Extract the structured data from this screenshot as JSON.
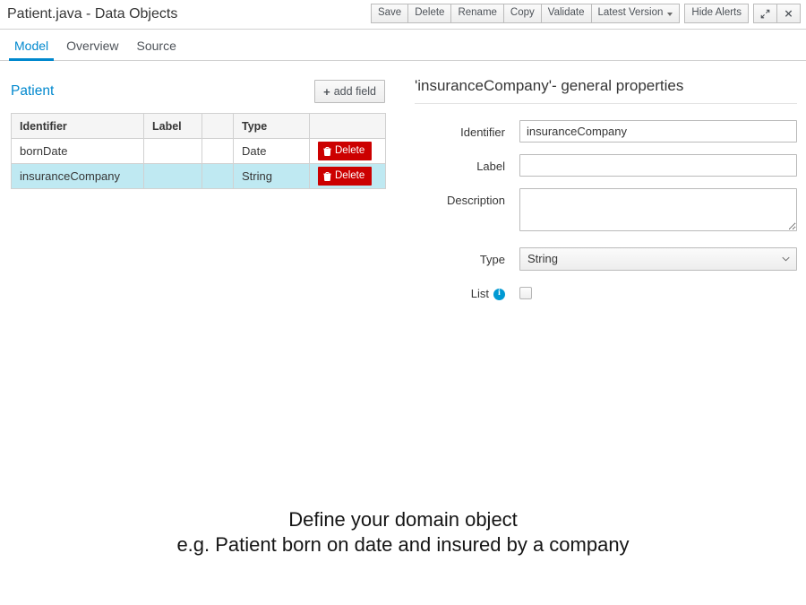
{
  "titlebar": {
    "document_title": "Patient.java - Data Objects",
    "buttons_group1": [
      {
        "label": "Save",
        "name": "save-button"
      },
      {
        "label": "Delete",
        "name": "delete-button"
      },
      {
        "label": "Rename",
        "name": "rename-button"
      },
      {
        "label": "Copy",
        "name": "copy-button"
      },
      {
        "label": "Validate",
        "name": "validate-button"
      },
      {
        "label": "Latest Version",
        "name": "latest-version-dropdown",
        "has_caret": true
      }
    ],
    "buttons_group2": [
      {
        "label": "Hide Alerts",
        "name": "hide-alerts-button"
      }
    ],
    "icon_buttons": [
      {
        "icon": "expand-icon",
        "name": "expand-button"
      },
      {
        "icon": "close-icon",
        "name": "close-button"
      }
    ]
  },
  "tabs": [
    {
      "label": "Model",
      "active": true
    },
    {
      "label": "Overview",
      "active": false
    },
    {
      "label": "Source",
      "active": false
    }
  ],
  "model": {
    "entity_name": "Patient",
    "add_field_label": "add field",
    "add_field_plus": "+",
    "table": {
      "headers": [
        "Identifier",
        "Label",
        "",
        "Type",
        ""
      ],
      "rows": [
        {
          "identifier": "bornDate",
          "label": "",
          "extra": "",
          "type": "Date",
          "action_label": "Delete",
          "selected": false
        },
        {
          "identifier": "insuranceCompany",
          "label": "",
          "extra": "",
          "type": "String",
          "action_label": "Delete",
          "selected": true
        }
      ]
    }
  },
  "properties": {
    "title": "'insuranceCompany'- general properties",
    "identifier_label": "Identifier",
    "identifier_value": "insuranceCompany",
    "label_label": "Label",
    "label_value": "",
    "description_label": "Description",
    "description_value": "",
    "type_label": "Type",
    "type_value": "String",
    "list_label": "List",
    "list_info_glyph": "i",
    "list_checked": false
  },
  "hint": {
    "line1": "Define your domain object",
    "line2": "e.g. Patient born on date and insured by a company"
  },
  "colors": {
    "accent_blue": "#0088ce",
    "danger_red": "#cc0000",
    "selected_row": "#bfe9f2",
    "info_blue": "#0099d3",
    "border_gray": "#d1d1d1"
  }
}
